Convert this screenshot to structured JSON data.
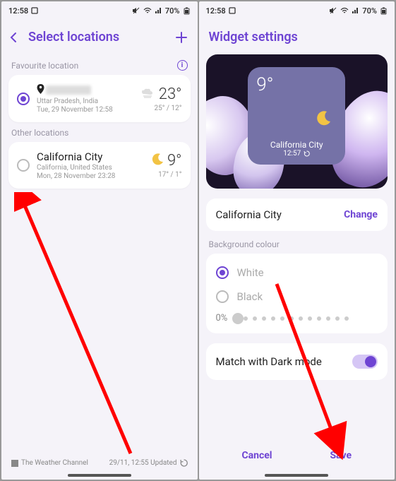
{
  "status": {
    "time": "12:58",
    "battery": "70%"
  },
  "screen1": {
    "title": "Select locations",
    "fav_label": "Favourite location",
    "other_label": "Other locations",
    "fav": {
      "sub1": "Uttar Pradesh, India",
      "sub2": "Tue, 29 November 12:58",
      "temp": "23°",
      "range": "25° / 12°"
    },
    "other": {
      "name": "California City",
      "sub1": "California, United States",
      "sub2": "Mon, 28 November 23:28",
      "temp": "9°",
      "range": "17° / 1°"
    },
    "footer_left": "The Weather Channel",
    "footer_right": "29/11, 12:55 Updated"
  },
  "screen2": {
    "title": "Widget settings",
    "widget": {
      "temp": "9°",
      "location": "California City",
      "time": "12:57"
    },
    "city": "California City",
    "change": "Change",
    "bg_label": "Background colour",
    "white": "White",
    "black": "Black",
    "slider_pct": "0%",
    "darkmode": "Match with Dark mode",
    "cancel": "Cancel",
    "save": "Save"
  }
}
